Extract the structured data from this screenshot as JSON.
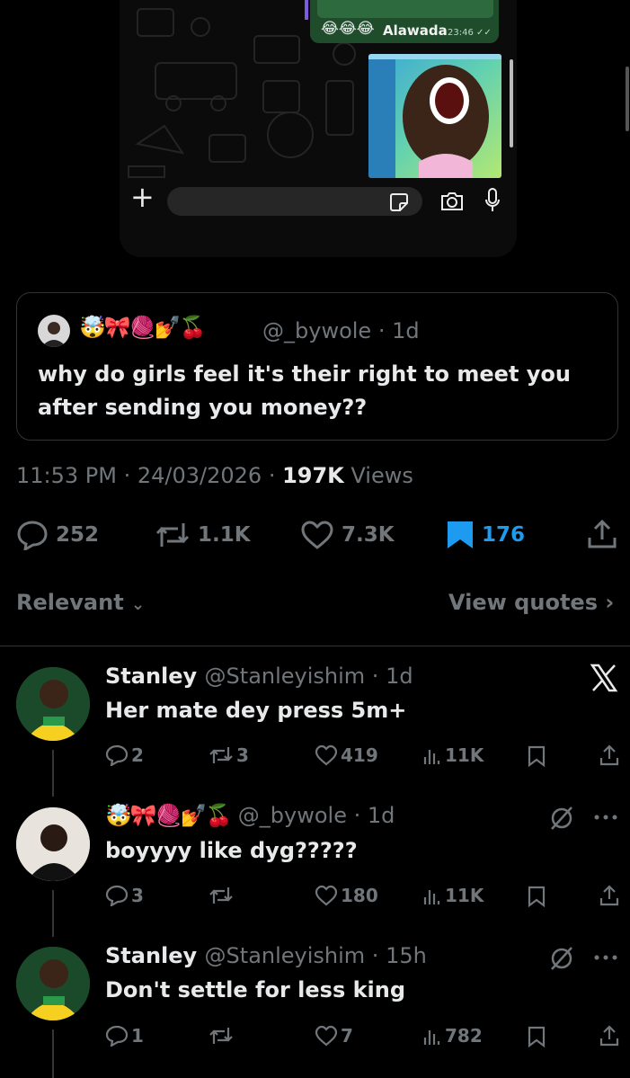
{
  "whatsapp": {
    "emojis": "😂😂😂",
    "sender": "Alawada",
    "time": "23:46 ✓✓"
  },
  "quote": {
    "emojis": "🤯🎀🧶💅🍒",
    "handle": "@_bywole · 1d",
    "text": "why do girls feel it's their right to meet you after sending you money??"
  },
  "meta": {
    "time": "11:53 PM · 24/03/2026 · ",
    "views_count": "197K",
    "views_label": " Views"
  },
  "actions": {
    "replies": "252",
    "reposts": "1.1K",
    "likes": "7.3K",
    "bookmarks": "176"
  },
  "colors": {
    "accent": "#1d9bf0",
    "muted": "#71767b",
    "text": "#e7e9ea"
  },
  "sort": {
    "relevant": "Relevant",
    "view_quotes": "View quotes"
  },
  "replies": [
    {
      "name": "Stanley",
      "handle": "@Stanleyishim · 1d",
      "text": "Her mate dey press 5m+",
      "replies": "2",
      "reposts": "3",
      "likes": "419",
      "views": "11K"
    },
    {
      "name": "🤯🎀🧶💅🍒",
      "handle": "@_bywole · 1d",
      "text": "boyyyy like dyg?????",
      "replies": "3",
      "reposts": "",
      "likes": "180",
      "views": "11K"
    },
    {
      "name": "Stanley",
      "handle": "@Stanleyishim · 15h",
      "text": "Don't settle for less king",
      "replies": "1",
      "reposts": "",
      "likes": "7",
      "views": "782"
    }
  ]
}
